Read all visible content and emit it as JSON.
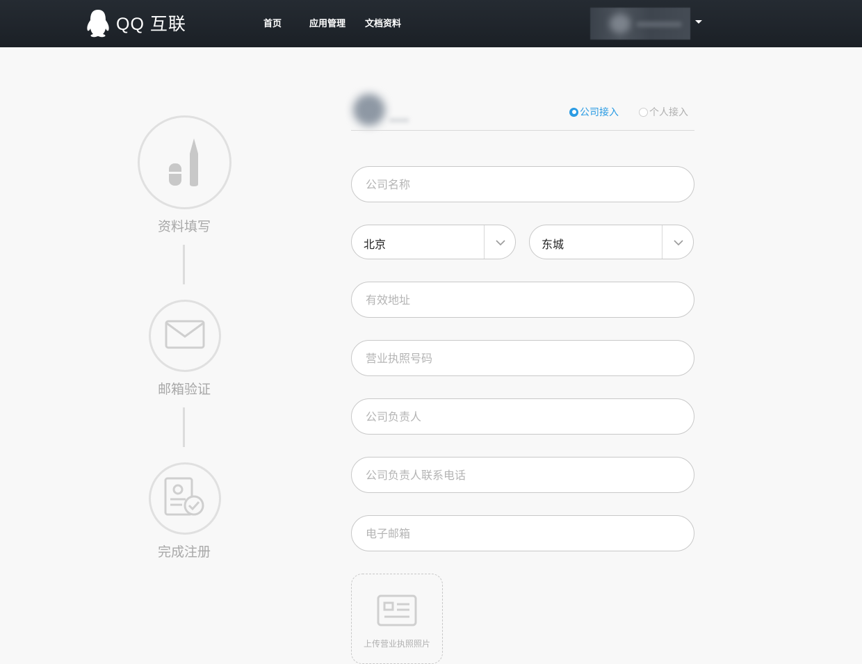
{
  "header": {
    "logo_text": "QQ 互联",
    "nav": [
      {
        "label": "首页"
      },
      {
        "label": "应用管理"
      },
      {
        "label": "文档资料"
      }
    ]
  },
  "steps": [
    {
      "label": "资料填写",
      "icon": "pen-icon"
    },
    {
      "label": "邮箱验证",
      "icon": "envelope-icon"
    },
    {
      "label": "完成注册",
      "icon": "certificate-check-icon"
    }
  ],
  "access_type": {
    "company": "公司接入",
    "personal": "个人接入",
    "selected": "company"
  },
  "form": {
    "company_name": {
      "placeholder": "公司名称",
      "value": ""
    },
    "province": {
      "value": "北京"
    },
    "district": {
      "value": "东城"
    },
    "address": {
      "placeholder": "有效地址",
      "value": ""
    },
    "license_no": {
      "placeholder": "营业执照号码",
      "value": ""
    },
    "principal": {
      "placeholder": "公司负责人",
      "value": ""
    },
    "principal_phone": {
      "placeholder": "公司负责人联系电话",
      "value": ""
    },
    "email": {
      "placeholder": "电子邮箱",
      "value": ""
    },
    "upload_label": "上传营业执照照片"
  },
  "colors": {
    "header_bg": "#20262d",
    "accent": "#2a9be3",
    "page_bg": "#f8f8f8",
    "muted": "#a8a8a8"
  }
}
